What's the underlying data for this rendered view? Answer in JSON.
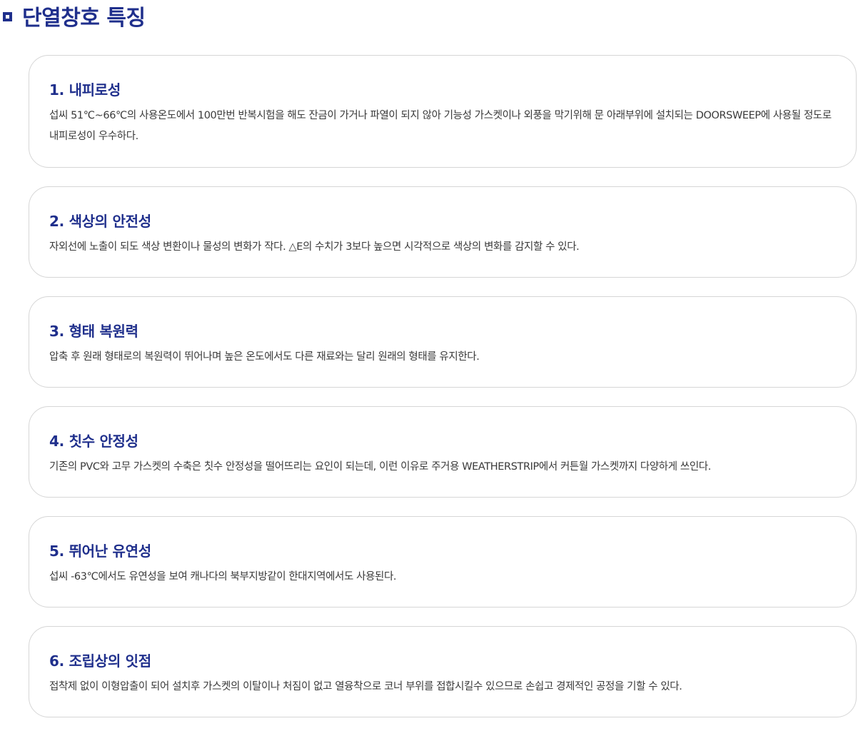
{
  "header": {
    "title": "단열창호 특징"
  },
  "features": [
    {
      "title": "1. 내피로성",
      "body": "섭씨 51℃~66℃의 사용온도에서 100만번 반복시험을 해도 잔금이 가거나 파열이 되지 않아 기능성 가스켓이나 외풍을 막기위해 문 아래부위에 설치되는 DOORSWEEP에 사용될 정도로 내피로성이 우수하다."
    },
    {
      "title": "2. 색상의 안전성",
      "body": "자외선에 노출이 되도 색상 변환이나 물성의 변화가 작다. △E의 수치가 3보다 높으면 시각적으로 색상의 변화를 감지할 수 있다."
    },
    {
      "title": "3. 형태 복원력",
      "body": "압축 후 원래 형태로의 복원력이 뛰어나며 높은 온도에서도 다른 재료와는 달리 원래의 형태를 유지한다."
    },
    {
      "title": "4. 칫수 안정성",
      "body": "기존의 PVC와 고무 가스켓의 수축은 칫수 안정성을 떨어뜨리는 요인이 되는데, 이런 이유로 주거용 WEATHERSTRIP에서 커튼월 가스켓까지 다양하게 쓰인다."
    },
    {
      "title": "5. 뛰어난 유연성",
      "body": "섭씨 -63℃에서도 유연성을 보여 캐나다의 북부지방같이 한대지역에서도 사용된다."
    },
    {
      "title": "6. 조립상의 잇점",
      "body": "접착제 없이 이형압출이 되어 설치후 가스켓의 이탈이나 처짐이 없고 열융착으로 코너 부위를 접합시킬수 있으므로 손쉽고 경제적인 공정을 기할 수 있다."
    }
  ]
}
